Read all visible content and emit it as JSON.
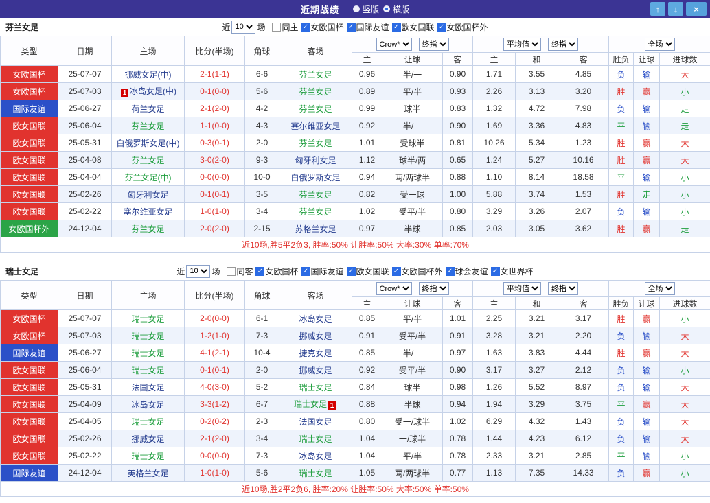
{
  "titlebar": {
    "title": "近期战绩",
    "radios": [
      {
        "label": "竖版",
        "selected": false
      },
      {
        "label": "横版",
        "selected": true
      }
    ],
    "buttons": [
      {
        "name": "move-up",
        "glyph": "↑"
      },
      {
        "name": "move-down",
        "glyph": "↓"
      },
      {
        "name": "close",
        "glyph": "×"
      }
    ]
  },
  "colors": {
    "titlebar_bg": "#3b3494",
    "button_blue": "#5ea9e0",
    "type_red": "#e1332e",
    "type_blue": "#2b50c8",
    "type_green": "#2ba447",
    "text_red": "#e1332e",
    "text_blue": "#2b50c8",
    "text_green": "#1f9e3e",
    "team_navy": "#253d8f",
    "row_alt": "#eef3fc",
    "border": "#c6d2e8"
  },
  "table_headers": {
    "main": [
      "类型",
      "日期",
      "主场",
      "比分(半场)",
      "角球",
      "客场"
    ],
    "group1_selects": [
      "Crow*",
      "终指"
    ],
    "group1_sub": [
      "主",
      "让球",
      "客"
    ],
    "group2_selects": [
      "平均值",
      "终指"
    ],
    "group2_sub": [
      "主",
      "和",
      "客"
    ],
    "group3_select": "全场",
    "group3_sub": [
      "胜负",
      "让球",
      "进球数"
    ]
  },
  "sections": [
    {
      "team": "芬兰女足",
      "filter": {
        "near": "近",
        "count": "10",
        "games": "场",
        "same": {
          "label": "同主",
          "checked": false
        },
        "comps": [
          {
            "label": "女欧国杯",
            "checked": true
          },
          {
            "label": "国际友谊",
            "checked": true
          },
          {
            "label": "欧女国联",
            "checked": true
          },
          {
            "label": "女欧国杯外",
            "checked": true
          }
        ]
      },
      "rows": [
        {
          "type": "女欧国杯",
          "tc": "red",
          "date": "25-07-07",
          "home": "挪威女足(中)",
          "hg": false,
          "hb": "",
          "score": "2-1(1-1)",
          "cn": "6-6",
          "away": "芬兰女足",
          "ag": true,
          "ab": "",
          "ohome": "0.96",
          "hcap": "半/一",
          "oaway": "0.90",
          "ah": "1.71",
          "ad": "3.55",
          "aa": "4.85",
          "wdl": [
            "负",
            "blue"
          ],
          "cover": [
            "输",
            "blue"
          ],
          "goals": [
            "大",
            "red"
          ]
        },
        {
          "type": "女欧国杯",
          "tc": "red",
          "date": "25-07-03",
          "home": "冰岛女足(中)",
          "hg": false,
          "hb": "1",
          "score": "0-1(0-0)",
          "cn": "5-6",
          "away": "芬兰女足",
          "ag": true,
          "ab": "",
          "ohome": "0.89",
          "hcap": "平/半",
          "oaway": "0.93",
          "ah": "2.26",
          "ad": "3.13",
          "aa": "3.20",
          "wdl": [
            "胜",
            "red"
          ],
          "cover": [
            "赢",
            "red"
          ],
          "goals": [
            "小",
            "green"
          ]
        },
        {
          "type": "国际友谊",
          "tc": "blue",
          "date": "25-06-27",
          "home": "荷兰女足",
          "hg": false,
          "hb": "",
          "score": "2-1(2-0)",
          "cn": "4-2",
          "away": "芬兰女足",
          "ag": true,
          "ab": "",
          "ohome": "0.99",
          "hcap": "球半",
          "oaway": "0.83",
          "ah": "1.32",
          "ad": "4.72",
          "aa": "7.98",
          "wdl": [
            "负",
            "blue"
          ],
          "cover": [
            "输",
            "blue"
          ],
          "goals": [
            "走",
            "green"
          ]
        },
        {
          "type": "欧女国联",
          "tc": "red",
          "date": "25-06-04",
          "home": "芬兰女足",
          "hg": true,
          "hb": "",
          "score": "1-1(0-0)",
          "cn": "4-3",
          "away": "塞尔维亚女足",
          "ag": false,
          "ab": "",
          "ohome": "0.92",
          "hcap": "半/一",
          "oaway": "0.90",
          "ah": "1.69",
          "ad": "3.36",
          "aa": "4.83",
          "wdl": [
            "平",
            "green"
          ],
          "cover": [
            "输",
            "blue"
          ],
          "goals": [
            "走",
            "green"
          ]
        },
        {
          "type": "欧女国联",
          "tc": "red",
          "date": "25-05-31",
          "home": "白俄罗斯女足(中)",
          "hg": false,
          "hb": "",
          "score": "0-3(0-1)",
          "cn": "2-0",
          "away": "芬兰女足",
          "ag": true,
          "ab": "",
          "ohome": "1.01",
          "hcap": "受球半",
          "oaway": "0.81",
          "ah": "10.26",
          "ad": "5.34",
          "aa": "1.23",
          "wdl": [
            "胜",
            "red"
          ],
          "cover": [
            "赢",
            "red"
          ],
          "goals": [
            "大",
            "red"
          ]
        },
        {
          "type": "欧女国联",
          "tc": "red",
          "date": "25-04-08",
          "home": "芬兰女足",
          "hg": true,
          "hb": "",
          "score": "3-0(2-0)",
          "cn": "9-3",
          "away": "匈牙利女足",
          "ag": false,
          "ab": "",
          "ohome": "1.12",
          "hcap": "球半/两",
          "oaway": "0.65",
          "ah": "1.24",
          "ad": "5.27",
          "aa": "10.16",
          "wdl": [
            "胜",
            "red"
          ],
          "cover": [
            "赢",
            "red"
          ],
          "goals": [
            "大",
            "red"
          ]
        },
        {
          "type": "欧女国联",
          "tc": "red",
          "date": "25-04-04",
          "home": "芬兰女足(中)",
          "hg": true,
          "hb": "",
          "score": "0-0(0-0)",
          "cn": "10-0",
          "away": "白俄罗斯女足",
          "ag": false,
          "ab": "",
          "ohome": "0.94",
          "hcap": "两/两球半",
          "oaway": "0.88",
          "ah": "1.10",
          "ad": "8.14",
          "aa": "18.58",
          "wdl": [
            "平",
            "green"
          ],
          "cover": [
            "输",
            "blue"
          ],
          "goals": [
            "小",
            "green"
          ]
        },
        {
          "type": "欧女国联",
          "tc": "red",
          "date": "25-02-26",
          "home": "匈牙利女足",
          "hg": false,
          "hb": "",
          "score": "0-1(0-1)",
          "cn": "3-5",
          "away": "芬兰女足",
          "ag": true,
          "ab": "",
          "ohome": "0.82",
          "hcap": "受一球",
          "oaway": "1.00",
          "ah": "5.88",
          "ad": "3.74",
          "aa": "1.53",
          "wdl": [
            "胜",
            "red"
          ],
          "cover": [
            "走",
            "green"
          ],
          "goals": [
            "小",
            "green"
          ]
        },
        {
          "type": "欧女国联",
          "tc": "red",
          "date": "25-02-22",
          "home": "塞尔维亚女足",
          "hg": false,
          "hb": "",
          "score": "1-0(1-0)",
          "cn": "3-4",
          "away": "芬兰女足",
          "ag": true,
          "ab": "",
          "ohome": "1.02",
          "hcap": "受平/半",
          "oaway": "0.80",
          "ah": "3.29",
          "ad": "3.26",
          "aa": "2.07",
          "wdl": [
            "负",
            "blue"
          ],
          "cover": [
            "输",
            "blue"
          ],
          "goals": [
            "小",
            "green"
          ]
        },
        {
          "type": "女欧国杯外",
          "tc": "green",
          "date": "24-12-04",
          "home": "芬兰女足",
          "hg": true,
          "hb": "",
          "score": "2-0(2-0)",
          "cn": "2-15",
          "away": "苏格兰女足",
          "ag": false,
          "ab": "",
          "ohome": "0.97",
          "hcap": "半球",
          "oaway": "0.85",
          "ah": "2.03",
          "ad": "3.05",
          "aa": "3.62",
          "wdl": [
            "胜",
            "red"
          ],
          "cover": [
            "赢",
            "red"
          ],
          "goals": [
            "走",
            "green"
          ]
        }
      ],
      "summary": "近10场,胜5平2负3, 胜率:50% 让胜率:50% 大率:30% 单率:70%"
    },
    {
      "team": "瑞士女足",
      "filter": {
        "near": "近",
        "count": "10",
        "games": "场",
        "same": {
          "label": "同客",
          "checked": false
        },
        "comps": [
          {
            "label": "女欧国杯",
            "checked": true
          },
          {
            "label": "国际友谊",
            "checked": true
          },
          {
            "label": "欧女国联",
            "checked": true
          },
          {
            "label": "女欧国杯外",
            "checked": true
          },
          {
            "label": "球会友谊",
            "checked": true
          },
          {
            "label": "女世界杯",
            "checked": true
          }
        ]
      },
      "rows": [
        {
          "type": "女欧国杯",
          "tc": "red",
          "date": "25-07-07",
          "home": "瑞士女足",
          "hg": true,
          "hb": "",
          "score": "2-0(0-0)",
          "cn": "6-1",
          "away": "冰岛女足",
          "ag": false,
          "ab": "",
          "ohome": "0.85",
          "hcap": "平/半",
          "oaway": "1.01",
          "ah": "2.25",
          "ad": "3.21",
          "aa": "3.17",
          "wdl": [
            "胜",
            "red"
          ],
          "cover": [
            "赢",
            "red"
          ],
          "goals": [
            "小",
            "green"
          ]
        },
        {
          "type": "女欧国杯",
          "tc": "red",
          "date": "25-07-03",
          "home": "瑞士女足",
          "hg": true,
          "hb": "",
          "score": "1-2(1-0)",
          "cn": "7-3",
          "away": "挪威女足",
          "ag": false,
          "ab": "",
          "ohome": "0.91",
          "hcap": "受平/半",
          "oaway": "0.91",
          "ah": "3.28",
          "ad": "3.21",
          "aa": "2.20",
          "wdl": [
            "负",
            "blue"
          ],
          "cover": [
            "输",
            "blue"
          ],
          "goals": [
            "大",
            "red"
          ]
        },
        {
          "type": "国际友谊",
          "tc": "blue",
          "date": "25-06-27",
          "home": "瑞士女足",
          "hg": true,
          "hb": "",
          "score": "4-1(2-1)",
          "cn": "10-4",
          "away": "捷克女足",
          "ag": false,
          "ab": "",
          "ohome": "0.85",
          "hcap": "半/一",
          "oaway": "0.97",
          "ah": "1.63",
          "ad": "3.83",
          "aa": "4.44",
          "wdl": [
            "胜",
            "red"
          ],
          "cover": [
            "赢",
            "red"
          ],
          "goals": [
            "大",
            "red"
          ]
        },
        {
          "type": "欧女国联",
          "tc": "red",
          "date": "25-06-04",
          "home": "瑞士女足",
          "hg": true,
          "hb": "",
          "score": "0-1(0-1)",
          "cn": "2-0",
          "away": "挪威女足",
          "ag": false,
          "ab": "",
          "ohome": "0.92",
          "hcap": "受平/半",
          "oaway": "0.90",
          "ah": "3.17",
          "ad": "3.27",
          "aa": "2.12",
          "wdl": [
            "负",
            "blue"
          ],
          "cover": [
            "输",
            "blue"
          ],
          "goals": [
            "小",
            "green"
          ]
        },
        {
          "type": "欧女国联",
          "tc": "red",
          "date": "25-05-31",
          "home": "法国女足",
          "hg": false,
          "hb": "",
          "score": "4-0(3-0)",
          "cn": "5-2",
          "away": "瑞士女足",
          "ag": true,
          "ab": "",
          "ohome": "0.84",
          "hcap": "球半",
          "oaway": "0.98",
          "ah": "1.26",
          "ad": "5.52",
          "aa": "8.97",
          "wdl": [
            "负",
            "blue"
          ],
          "cover": [
            "输",
            "blue"
          ],
          "goals": [
            "大",
            "red"
          ]
        },
        {
          "type": "欧女国联",
          "tc": "red",
          "date": "25-04-09",
          "home": "冰岛女足",
          "hg": false,
          "hb": "",
          "score": "3-3(1-2)",
          "cn": "6-7",
          "away": "瑞士女足",
          "ag": true,
          "ab": "1",
          "ohome": "0.88",
          "hcap": "半球",
          "oaway": "0.94",
          "ah": "1.94",
          "ad": "3.29",
          "aa": "3.75",
          "wdl": [
            "平",
            "green"
          ],
          "cover": [
            "赢",
            "red"
          ],
          "goals": [
            "大",
            "red"
          ]
        },
        {
          "type": "欧女国联",
          "tc": "red",
          "date": "25-04-05",
          "home": "瑞士女足",
          "hg": true,
          "hb": "",
          "score": "0-2(0-2)",
          "cn": "2-3",
          "away": "法国女足",
          "ag": false,
          "ab": "",
          "ohome": "0.80",
          "hcap": "受一/球半",
          "oaway": "1.02",
          "ah": "6.29",
          "ad": "4.32",
          "aa": "1.43",
          "wdl": [
            "负",
            "blue"
          ],
          "cover": [
            "输",
            "blue"
          ],
          "goals": [
            "大",
            "red"
          ]
        },
        {
          "type": "欧女国联",
          "tc": "red",
          "date": "25-02-26",
          "home": "挪威女足",
          "hg": false,
          "hb": "",
          "score": "2-1(2-0)",
          "cn": "3-4",
          "away": "瑞士女足",
          "ag": true,
          "ab": "",
          "ohome": "1.04",
          "hcap": "一/球半",
          "oaway": "0.78",
          "ah": "1.44",
          "ad": "4.23",
          "aa": "6.12",
          "wdl": [
            "负",
            "blue"
          ],
          "cover": [
            "输",
            "blue"
          ],
          "goals": [
            "大",
            "red"
          ]
        },
        {
          "type": "欧女国联",
          "tc": "red",
          "date": "25-02-22",
          "home": "瑞士女足",
          "hg": true,
          "hb": "",
          "score": "0-0(0-0)",
          "cn": "7-3",
          "away": "冰岛女足",
          "ag": false,
          "ab": "",
          "ohome": "1.04",
          "hcap": "平/半",
          "oaway": "0.78",
          "ah": "2.33",
          "ad": "3.21",
          "aa": "2.85",
          "wdl": [
            "平",
            "green"
          ],
          "cover": [
            "输",
            "blue"
          ],
          "goals": [
            "小",
            "green"
          ]
        },
        {
          "type": "国际友谊",
          "tc": "blue",
          "date": "24-12-04",
          "home": "英格兰女足",
          "hg": false,
          "hb": "",
          "score": "1-0(1-0)",
          "cn": "5-6",
          "away": "瑞士女足",
          "ag": true,
          "ab": "",
          "ohome": "1.05",
          "hcap": "两/两球半",
          "oaway": "0.77",
          "ah": "1.13",
          "ad": "7.35",
          "aa": "14.33",
          "wdl": [
            "负",
            "blue"
          ],
          "cover": [
            "赢",
            "red"
          ],
          "goals": [
            "小",
            "green"
          ]
        }
      ],
      "summary": "近10场,胜2平2负6, 胜率:20% 让胜率:50% 大率:50% 单率:50%"
    }
  ]
}
